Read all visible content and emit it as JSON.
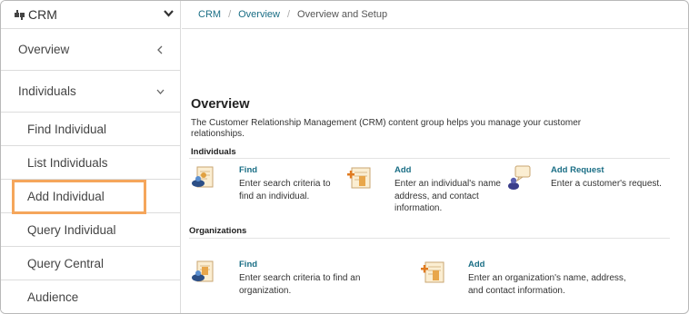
{
  "sidebar": {
    "app_name": "CRM",
    "items": [
      {
        "label": "Overview"
      },
      {
        "label": "Individuals"
      }
    ],
    "sub_items": [
      {
        "label": "Find Individual"
      },
      {
        "label": "List Individuals"
      },
      {
        "label": "Add Individual"
      },
      {
        "label": "Query Individual"
      },
      {
        "label": "Query Central"
      },
      {
        "label": "Audience"
      }
    ]
  },
  "breadcrumb": {
    "items": [
      "CRM",
      "Overview",
      "Overview and Setup"
    ]
  },
  "main": {
    "title": "Overview",
    "description": "The Customer Relationship Management (CRM) content group helps you manage your customer relationships.",
    "individuals": {
      "label": "Individuals",
      "actions": [
        {
          "title": "Find",
          "desc": "Enter search criteria to find an individual."
        },
        {
          "title": "Add",
          "desc": "Enter an individual's name address, and contact information."
        },
        {
          "title": "Add Request",
          "desc": "Enter a customer's request."
        }
      ]
    },
    "organizations": {
      "label": "Organizations",
      "actions": [
        {
          "title": "Find",
          "desc": "Enter search criteria to find an organization."
        },
        {
          "title": "Add",
          "desc": "Enter an organization's name, address, and contact information."
        }
      ]
    }
  },
  "colors": {
    "link": "#1a6e85",
    "highlight": "#f5a65b"
  }
}
